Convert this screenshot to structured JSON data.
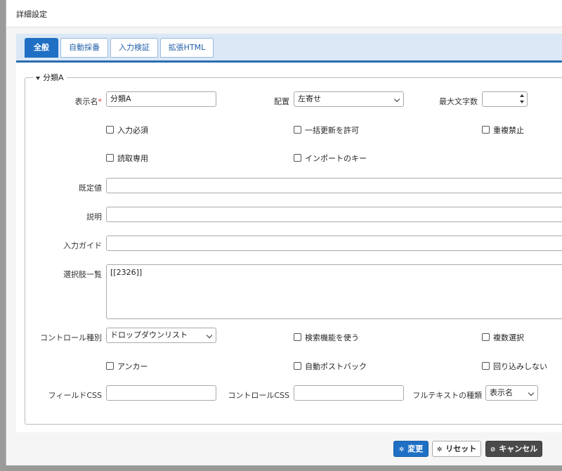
{
  "dialog": {
    "title": "詳細設定"
  },
  "tabs": [
    {
      "label": "全般",
      "active": true
    },
    {
      "label": "自動採番"
    },
    {
      "label": "入力検証"
    },
    {
      "label": "拡張HTML"
    }
  ],
  "section": {
    "legend": "分類A"
  },
  "form": {
    "display_name": {
      "label": "表示名",
      "required_mark": "*",
      "value": "分類A"
    },
    "alignment": {
      "label": "配置",
      "value": "左寄せ"
    },
    "max_length": {
      "label": "最大文字数",
      "value": ""
    },
    "checkboxes_row1": [
      "入力必須",
      "一括更新を許可",
      "重複禁止"
    ],
    "checkboxes_row2": [
      "読取専用",
      "インポートのキー"
    ],
    "default_value": {
      "label": "既定値",
      "value": ""
    },
    "description": {
      "label": "説明",
      "value": ""
    },
    "input_guide": {
      "label": "入力ガイド",
      "value": ""
    },
    "choices": {
      "label": "選択肢一覧",
      "value": "[[2326]]"
    },
    "control_type": {
      "label": "コントロール種別",
      "value": "ドロップダウンリスト"
    },
    "checkboxes_row3": [
      "検索機能を使う",
      "複数選択"
    ],
    "checkboxes_row4": [
      "アンカー",
      "自動ポストバック",
      "回り込みしない"
    ],
    "field_css": {
      "label": "フィールドCSS",
      "value": ""
    },
    "control_css": {
      "label": "コントロールCSS",
      "value": ""
    },
    "fulltext_type": {
      "label": "フルテキストの種類",
      "value": "表示名"
    }
  },
  "buttons": {
    "change": "変更",
    "reset": "リセット",
    "cancel": "キャンセル"
  }
}
